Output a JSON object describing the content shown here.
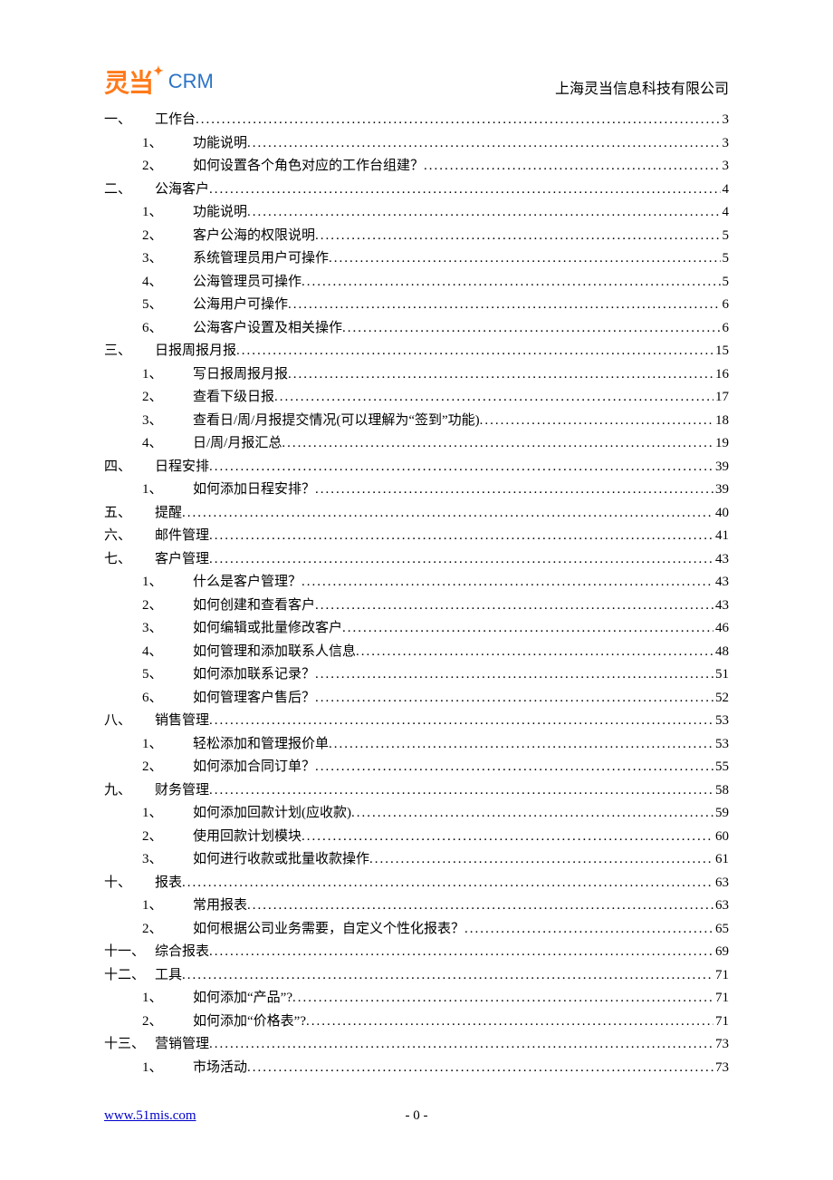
{
  "header": {
    "logo_cn": "灵当",
    "logo_en": "CRM",
    "company": "上海灵当信息科技有限公司"
  },
  "toc": [
    {
      "level": 1,
      "num": "一、",
      "title": "工作台",
      "page": "3"
    },
    {
      "level": 2,
      "num": "1、",
      "title": "功能说明",
      "page": "3"
    },
    {
      "level": 2,
      "num": "2、",
      "title": "如何设置各个角色对应的工作台组建？",
      "page": "3"
    },
    {
      "level": 1,
      "num": "二、",
      "title": "公海客户",
      "page": "4"
    },
    {
      "level": 2,
      "num": "1、",
      "title": "功能说明",
      "page": "4"
    },
    {
      "level": 2,
      "num": "2、",
      "title": "客户公海的权限说明",
      "page": "5"
    },
    {
      "level": 2,
      "num": "3、",
      "title": "系统管理员用户可操作",
      "page": "5"
    },
    {
      "level": 2,
      "num": "4、",
      "title": "公海管理员可操作",
      "page": "5"
    },
    {
      "level": 2,
      "num": "5、",
      "title": "公海用户可操作",
      "page": "6"
    },
    {
      "level": 2,
      "num": "6、",
      "title": "公海客户设置及相关操作",
      "page": "6"
    },
    {
      "level": 1,
      "num": "三、",
      "title": "日报周报月报",
      "page": "15"
    },
    {
      "level": 2,
      "num": "1、",
      "title": "写日报周报月报",
      "page": "16"
    },
    {
      "level": 2,
      "num": "2、",
      "title": "查看下级日报",
      "page": "17"
    },
    {
      "level": 2,
      "num": "3、",
      "title": "查看日/周/月报提交情况(可以理解为“签到”功能)",
      "page": "18"
    },
    {
      "level": 2,
      "num": "4、",
      "title": "日/周/月报汇总",
      "page": "19"
    },
    {
      "level": 1,
      "num": "四、",
      "title": "日程安排",
      "page": "39"
    },
    {
      "level": 2,
      "num": "1、",
      "title": "如何添加日程安排？",
      "page": "39"
    },
    {
      "level": 1,
      "num": "五、",
      "title": "提醒",
      "page": "40"
    },
    {
      "level": 1,
      "num": "六、",
      "title": "邮件管理",
      "page": "41"
    },
    {
      "level": 1,
      "num": "七、",
      "title": "客户管理",
      "page": "43"
    },
    {
      "level": 2,
      "num": "1、",
      "title": "什么是客户管理？",
      "page": "43"
    },
    {
      "level": 2,
      "num": "2、",
      "title": "如何创建和查看客户",
      "page": "43"
    },
    {
      "level": 2,
      "num": "3、",
      "title": "如何编辑或批量修改客户",
      "page": "46"
    },
    {
      "level": 2,
      "num": "4、",
      "title": "如何管理和添加联系人信息",
      "page": "48"
    },
    {
      "level": 2,
      "num": "5、",
      "title": "如何添加联系记录？",
      "page": "51"
    },
    {
      "level": 2,
      "num": "6、",
      "title": "如何管理客户售后？",
      "page": "52"
    },
    {
      "level": 1,
      "num": "八、",
      "title": "销售管理",
      "page": "53"
    },
    {
      "level": 2,
      "num": "1、",
      "title": "轻松添加和管理报价单",
      "page": "53"
    },
    {
      "level": 2,
      "num": "2、",
      "title": "如何添加合同订单？",
      "page": "55"
    },
    {
      "level": 1,
      "num": "九、",
      "title": "财务管理",
      "page": "58"
    },
    {
      "level": 2,
      "num": "1、",
      "title": "如何添加回款计划(应收款)",
      "page": "59"
    },
    {
      "level": 2,
      "num": "2、",
      "title": "使用回款计划模块",
      "page": "60"
    },
    {
      "level": 2,
      "num": "3、",
      "title": "如何进行收款或批量收款操作",
      "page": "61"
    },
    {
      "level": 1,
      "num": "十、",
      "title": "报表",
      "page": "63"
    },
    {
      "level": 2,
      "num": "1、",
      "title": "常用报表",
      "page": "63"
    },
    {
      "level": 2,
      "num": "2、",
      "title": "如何根据公司业务需要，自定义个性化报表？",
      "page": "65"
    },
    {
      "level": 1,
      "num": "十一、",
      "title": "综合报表",
      "page": "69"
    },
    {
      "level": 1,
      "num": "十二、",
      "title": "工具",
      "page": "71"
    },
    {
      "level": 2,
      "num": "1、",
      "title": "如何添加“产品”?",
      "page": "71"
    },
    {
      "level": 2,
      "num": "2、",
      "title": "如何添加“价格表”?",
      "page": "71"
    },
    {
      "level": 1,
      "num": "十三、",
      "title": "营销管理",
      "page": "73"
    },
    {
      "level": 2,
      "num": "1、",
      "title": "市场活动",
      "page": "73"
    }
  ],
  "footer": {
    "url": "www.51mis.com",
    "page_label": "- 0 -"
  }
}
